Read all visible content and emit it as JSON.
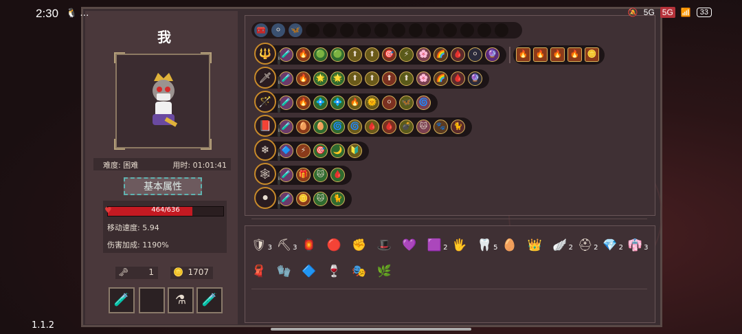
{
  "status_bar": {
    "time": "2:30",
    "left_icons": "…",
    "right_icons": [
      "5G",
      "5G",
      "WiFi"
    ],
    "battery": "33"
  },
  "player": {
    "name": "我",
    "difficulty": "难度: 困难",
    "play_time": "用时: 01:01:41"
  },
  "attributes": {
    "button_label": "基本属性",
    "hp_text": "464/636",
    "hp_fraction": 0.73,
    "move_speed": "移动速度: 5.94",
    "damage_bonus": "伤害加成: 1190%"
  },
  "resources": {
    "keys": "1",
    "coins": "1707"
  },
  "consumable_slots": [
    "yellow-potion-icon",
    "empty-slot",
    "white-flask-icon",
    "yellow-potion-icon"
  ],
  "top_strip": {
    "items": [
      "chest-icon",
      "stone-orb-icon",
      "blue-butterfly-icon"
    ],
    "empty_count": 12
  },
  "weapon_rows": [
    {
      "weapon": "crimson-staff-icon",
      "upgrades": [
        "🧪",
        "🔥",
        "🟢",
        "🟢",
        "⬆",
        "⬆",
        "🎯",
        "⚡",
        "🌸",
        "🌈",
        "🩸",
        "⚪",
        "🔮"
      ],
      "extras": [
        "🔥",
        "🔥",
        "🔥",
        "🔥",
        "🪙"
      ]
    },
    {
      "weapon": "purple-lance-icon",
      "upgrades": [
        "🧪",
        "🔥",
        "🌟",
        "🌟",
        "⬆",
        "⬆",
        "⬆",
        "⬆",
        "🌸",
        "🌈",
        "🩸",
        "🔮"
      ],
      "extras": []
    },
    {
      "weapon": "blue-rod-icon",
      "upgrades": [
        "🧪",
        "🔥",
        "💠",
        "💠",
        "🔥",
        "🌞",
        "⚪",
        "🦋",
        "🌀"
      ],
      "extras": []
    },
    {
      "weapon": "purple-grimoire-icon",
      "upgrades": [
        "🧪",
        "🥚",
        "🥚",
        "🌀",
        "🌀",
        "🩸",
        "🩸",
        "💣",
        "🐱",
        "🐾",
        "🐈"
      ],
      "extras": []
    },
    {
      "weapon": "ice-orb-icon",
      "upgrades": [
        "🔷",
        "⚡",
        "🎯",
        "🌙",
        "🔰"
      ],
      "extras": []
    },
    {
      "weapon": "dark-staff-icon",
      "upgrades": [
        "🧪",
        "🎁",
        "🐱",
        "🩸"
      ],
      "extras": []
    },
    {
      "weapon": "void-staff-icon",
      "upgrades": [
        "🧪",
        "🪙",
        "🐱",
        "🐈"
      ],
      "extras": []
    }
  ],
  "relics": [
    {
      "icon": "ghost-shield-icon",
      "count": "3"
    },
    {
      "icon": "pickaxe-icon",
      "count": "3"
    },
    {
      "icon": "lantern-icon",
      "count": ""
    },
    {
      "icon": "red-eye-icon",
      "count": ""
    },
    {
      "icon": "golden-fist-icon",
      "count": ""
    },
    {
      "icon": "purple-hat-icon",
      "count": ""
    },
    {
      "icon": "purple-gem-icon",
      "count": ""
    },
    {
      "icon": "runic-box-icon",
      "count": "2"
    },
    {
      "icon": "bronze-hand-icon",
      "count": ""
    },
    {
      "icon": "fang-icon",
      "count": "5"
    },
    {
      "icon": "egg-icon",
      "count": ""
    },
    {
      "icon": "golden-crown-icon",
      "count": ""
    },
    {
      "icon": "golden-wing-icon",
      "count": "2"
    },
    {
      "icon": "dark-helm-icon",
      "count": "2"
    },
    {
      "icon": "crystal-icon",
      "count": "2"
    },
    {
      "icon": "purple-robe-icon",
      "count": "3"
    },
    {
      "icon": "scarf-icon",
      "count": ""
    },
    {
      "icon": "blue-gauntlet-icon",
      "count": ""
    },
    {
      "icon": "blue-shard-icon",
      "count": ""
    },
    {
      "icon": "potion-gourd-icon",
      "count": ""
    },
    {
      "icon": "mask-icon",
      "count": ""
    },
    {
      "icon": "vine-icon",
      "count": ""
    }
  ],
  "version": "1.1.2",
  "colors": {
    "hp": "#c41a22",
    "accent": "#5fb3b0",
    "gold": "#d9b45a"
  }
}
